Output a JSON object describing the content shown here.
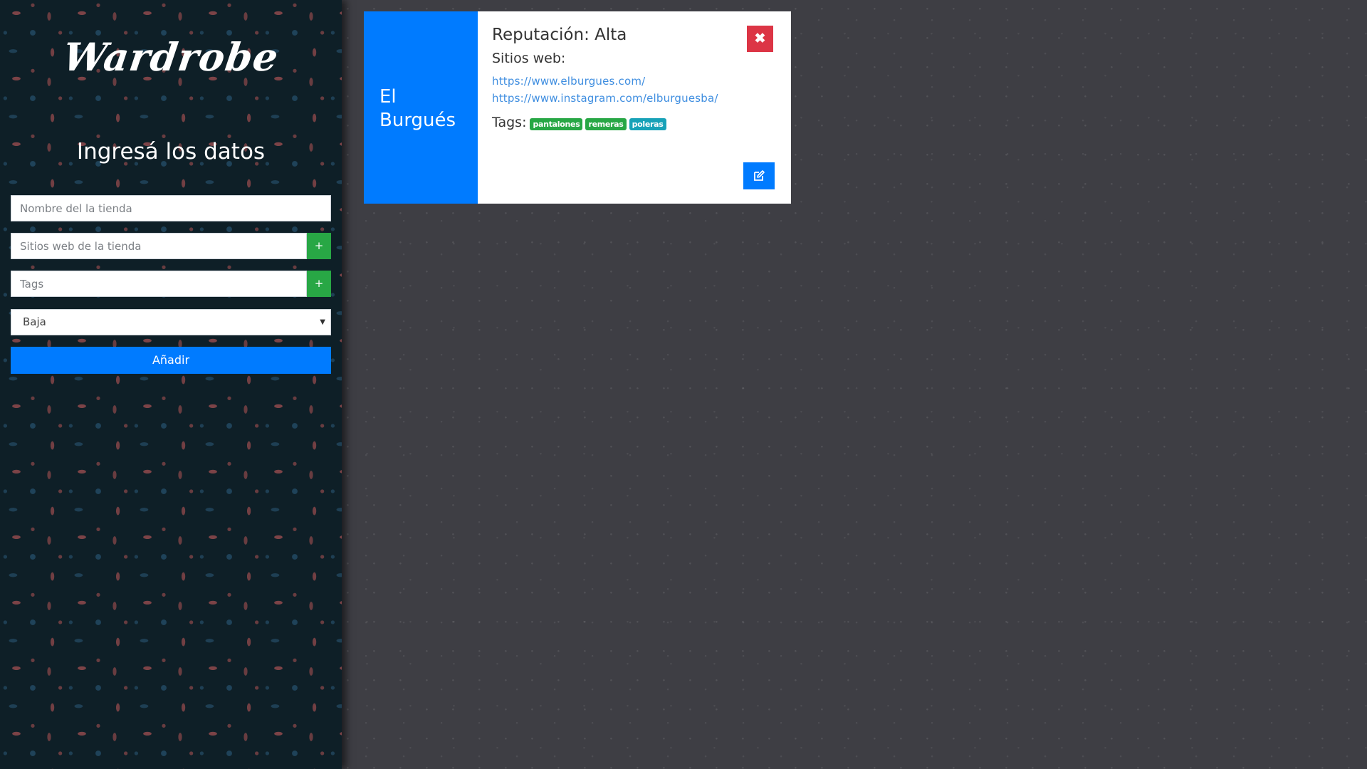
{
  "sidebar": {
    "logo": "Wardrobe",
    "title": "Ingresá los datos",
    "store_name_placeholder": "Nombre del la tienda",
    "websites_placeholder": "Sitios web de la tienda",
    "tags_placeholder": "Tags",
    "add_website_label": "+",
    "add_tag_label": "+",
    "reputation_select": {
      "selected": "Baja"
    },
    "add_button": "Añadir"
  },
  "card": {
    "store_name": "El Burgués",
    "reputation": "Reputación: Alta",
    "sites_label": "Sitios web:",
    "sites": [
      "https://www.elburgues.com/",
      "https://www.instagram.com/elburguesba/"
    ],
    "tags_label": "Tags:",
    "tags": [
      "pantalones",
      "remeras",
      "poleras"
    ],
    "close_label": "✖",
    "colors": {
      "side": "#007bff",
      "delete": "#dc3545",
      "edit": "#007bff",
      "tag_green": "#28a745",
      "tag_teal": "#17a2b8"
    },
    "icons": {
      "close": "close-icon",
      "edit": "edit-icon"
    }
  }
}
